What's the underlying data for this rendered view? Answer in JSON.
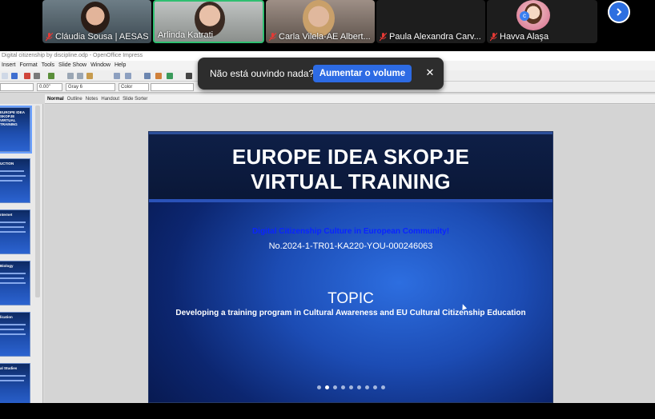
{
  "participants": [
    {
      "name": "Cláudia Sousa | AESAS",
      "muted": true,
      "active": false
    },
    {
      "name": "Arlinda Katrati",
      "muted": false,
      "active": true
    },
    {
      "name": "Carla Vilela-AE Albert...",
      "muted": true,
      "active": false
    },
    {
      "name": "Paula Alexandra Carv...",
      "muted": true,
      "active": false
    },
    {
      "name": "Havva Alaşa",
      "muted": true,
      "active": false
    }
  ],
  "colors": {
    "active_border": "#2fbf71",
    "muted_icon": "#e53935",
    "accent_blue": "#2d6be4",
    "slide_subtitle_blue": "#0a24ff"
  },
  "app": {
    "window_title": "Digital citizenship by discipline.odp - OpenOffice Impress",
    "menu": [
      "Insert",
      "Format",
      "Tools",
      "Slide Show",
      "Window",
      "Help"
    ],
    "line_width_value": "0.00\"",
    "fill_color": "Gray 6",
    "fill_type": "Color",
    "view_tabs": [
      "Normal",
      "Outline",
      "Notes",
      "Handout",
      "Slide Sorter"
    ],
    "selected_tab": "Normal"
  },
  "thumbnails": [
    {
      "title": "EUROPE IDEA SKOPJE\nVIRTUAL TRAINING",
      "selected": true
    },
    {
      "title": "UCTION",
      "selected": false
    },
    {
      "title": "nternet",
      "selected": false
    },
    {
      "title": "Biology",
      "selected": false
    },
    {
      "title": "lication",
      "selected": false
    },
    {
      "title": "al Studies",
      "selected": false
    }
  ],
  "slide": {
    "title_line1": "EUROPE IDEA SKOPJE",
    "title_line2": "VIRTUAL TRAINING",
    "subtitle": "Digital Citizenship Culture in European Community!",
    "project_number": "No.2024-1-TR01-KA220-YOU-000246063",
    "topic_label": "TOPIC",
    "topic_description": "Developing a training program in Cultural Awareness and EU Cultural Citizenship Education",
    "pager_total": 9,
    "pager_current": 2
  },
  "toast": {
    "message": "Não está ouvindo nada?",
    "action_label": "Aumentar o volume",
    "close_icon": "close-icon"
  }
}
